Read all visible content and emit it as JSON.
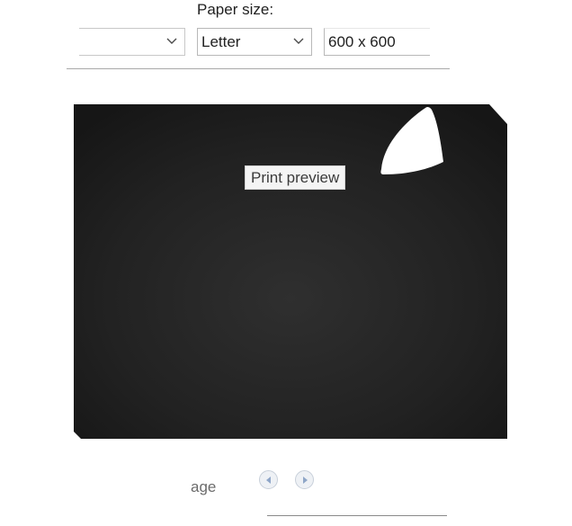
{
  "paper_size": {
    "label": "Paper size:",
    "selected": "Letter"
  },
  "left_select": {
    "selected": ""
  },
  "size_input": {
    "value": "600 x 600"
  },
  "preview": {
    "overlay_label": "Print preview"
  },
  "pagination": {
    "label": "age"
  },
  "colors": {
    "preview_background": "#1e1e1e",
    "accent_arrow": "#8fa6c8"
  }
}
